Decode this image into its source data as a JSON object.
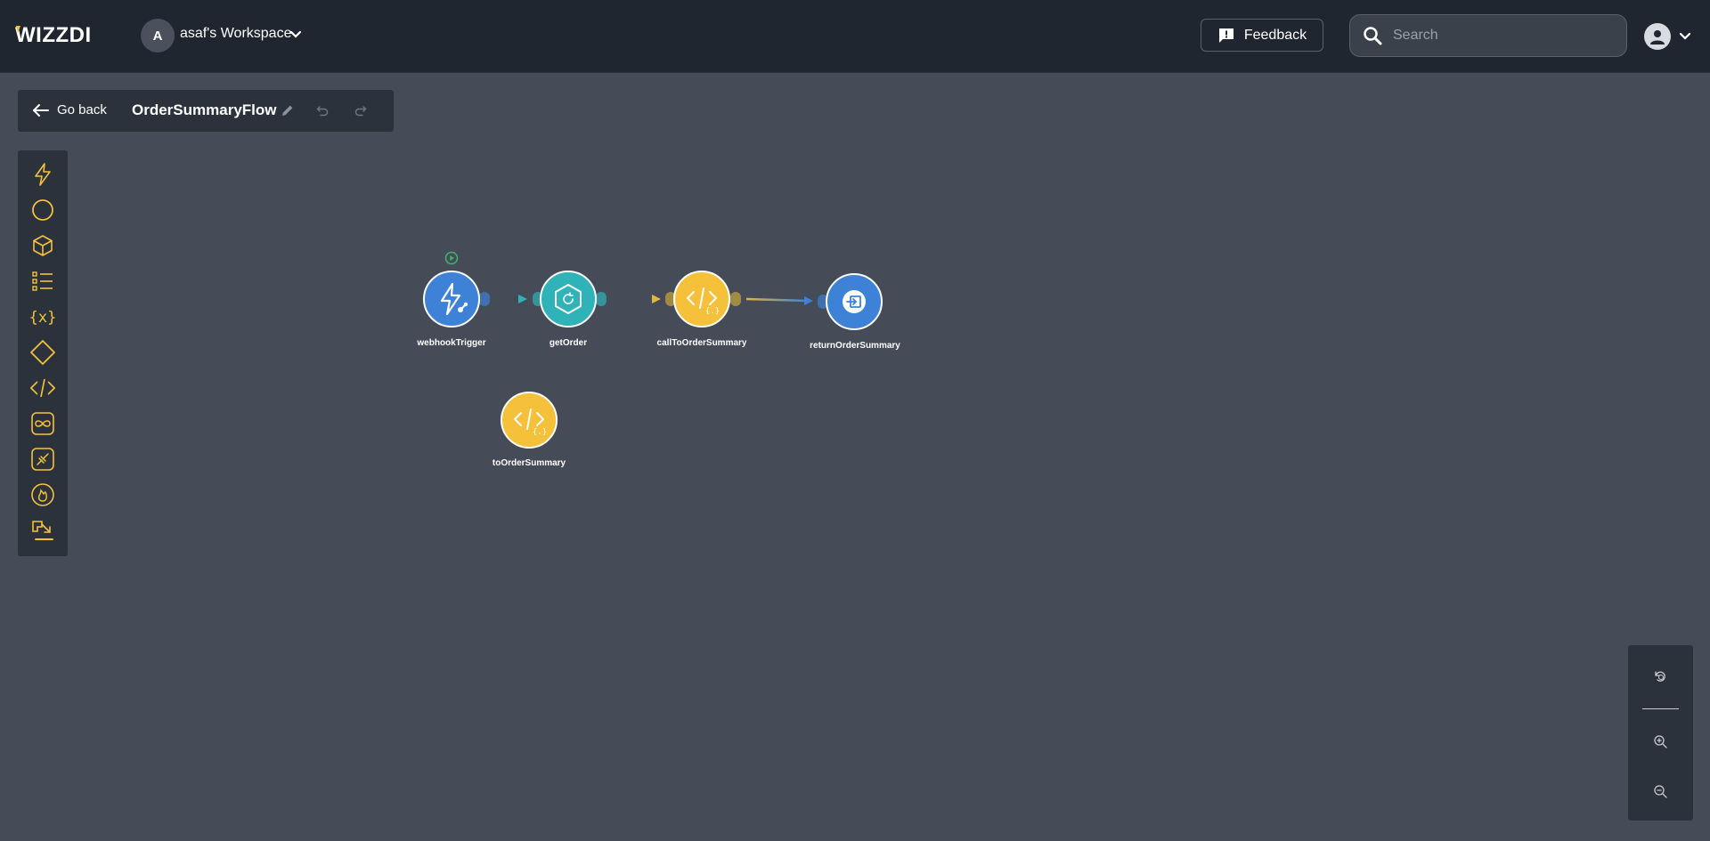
{
  "brand": {
    "logo_text": "WIZZDI",
    "accent_color": "#f6c13a"
  },
  "workspace": {
    "avatar_letter": "A",
    "name": "asaf's Workspace"
  },
  "feedback": {
    "label": "Feedback"
  },
  "search": {
    "placeholder": "Search",
    "value": ""
  },
  "flow": {
    "back_label": "Go back",
    "title": "OrderSummaryFlow"
  },
  "toolbar": {
    "tools": [
      "trigger-icon",
      "circle-icon",
      "cube-icon",
      "list-icon",
      "variable-icon",
      "diamond-icon",
      "code-icon",
      "loop-icon",
      "integration-icon",
      "fire-icon",
      "mapper-icon"
    ]
  },
  "nodes": [
    {
      "label": "webhookTrigger",
      "color": "#3d82d6",
      "icon": "bolt-webhook-icon"
    },
    {
      "label": "getOrder",
      "color": "#2fb2b8",
      "icon": "cube-refresh-icon"
    },
    {
      "label": "callToOrderSummary",
      "color": "#f6c13a",
      "icon": "code-icon"
    },
    {
      "label": "returnOrderSummary",
      "color": "#3d82d6",
      "icon": "return-icon"
    },
    {
      "label": "toOrderSummary",
      "color": "#f6c13a",
      "icon": "code-icon"
    }
  ],
  "zoom": {
    "controls": [
      "reset-zoom-icon",
      "zoom-in-icon",
      "zoom-out-icon"
    ]
  },
  "colors": {
    "topbar": "#1f2630",
    "panel": "#2b323c",
    "canvas": "#454c57",
    "blue": "#3d82d6",
    "teal": "#2fb2b8",
    "yellow": "#f6c13a",
    "run_green": "#3fb56e"
  }
}
